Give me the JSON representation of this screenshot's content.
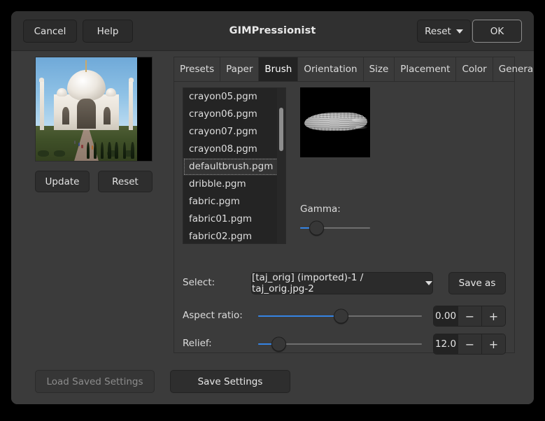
{
  "window": {
    "title": "GIMPressionist",
    "header_buttons": {
      "cancel": "Cancel",
      "help": "Help",
      "reset": "Reset",
      "ok": "OK"
    }
  },
  "preview": {
    "update_label": "Update",
    "reset_label": "Reset",
    "image_subject": "taj-mahal-photo"
  },
  "tabs": [
    {
      "label": "Presets",
      "active": false
    },
    {
      "label": "Paper",
      "active": false
    },
    {
      "label": "Brush",
      "active": true
    },
    {
      "label": "Orientation",
      "active": false
    },
    {
      "label": "Size",
      "active": false
    },
    {
      "label": "Placement",
      "active": false
    },
    {
      "label": "Color",
      "active": false
    },
    {
      "label": "General",
      "active": false
    }
  ],
  "brush_tab": {
    "brush_list": [
      {
        "name": "crayon05.pgm",
        "selected": false
      },
      {
        "name": "crayon06.pgm",
        "selected": false
      },
      {
        "name": "crayon07.pgm",
        "selected": false
      },
      {
        "name": "crayon08.pgm",
        "selected": false
      },
      {
        "name": "defaultbrush.pgm",
        "selected": true
      },
      {
        "name": "dribble.pgm",
        "selected": false
      },
      {
        "name": "fabric.pgm",
        "selected": false
      },
      {
        "name": "fabric01.pgm",
        "selected": false
      },
      {
        "name": "fabric02.pgm",
        "selected": false
      }
    ],
    "gamma": {
      "label": "Gamma:",
      "fill_percent": 22
    },
    "select": {
      "label": "Select:",
      "value": "[taj_orig] (imported)-1 / taj_orig.jpg-2",
      "save_as_label": "Save as"
    },
    "aspect_ratio": {
      "label": "Aspect ratio:",
      "value": "0.00",
      "fill_percent": 50,
      "minus_label": "−",
      "plus_label": "+"
    },
    "relief": {
      "label": "Relief:",
      "value": "12.0",
      "fill_percent": 12,
      "minus_label": "−",
      "plus_label": "+"
    }
  },
  "footer": {
    "load_saved_settings": "Load Saved Settings",
    "save_settings": "Save Settings"
  },
  "colors": {
    "accent": "#3584e4",
    "window_bg": "#3b3b3b",
    "header_bg": "#303030",
    "list_bg": "#242424"
  }
}
